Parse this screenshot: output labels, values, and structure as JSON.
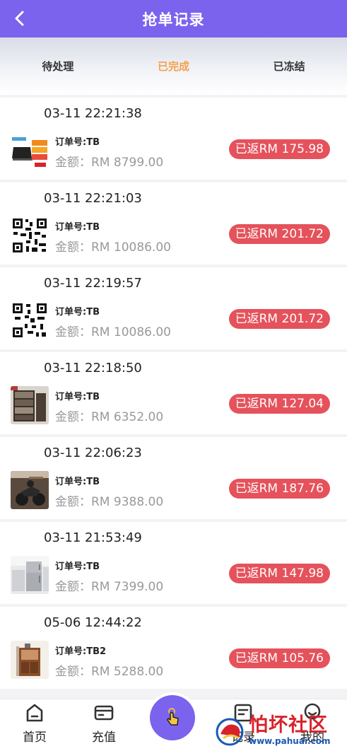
{
  "header": {
    "title": "抢单记录",
    "back_icon": "chevron-left-icon"
  },
  "tabs": [
    {
      "label": "待处理",
      "active": false
    },
    {
      "label": "已完成",
      "active": true
    },
    {
      "label": "已冻结",
      "active": false
    }
  ],
  "orders": [
    {
      "time": "03-11 22:21:38",
      "order_no": "订单号:TB",
      "amount": "金额：RM 8799.00",
      "rebate": "已返RM 175.98",
      "thumb": "laptop-image"
    },
    {
      "time": "03-11 22:21:03",
      "order_no": "订单号:TB",
      "amount": "金额：RM 10086.00",
      "rebate": "已返RM 201.72",
      "thumb": "qr-code-image"
    },
    {
      "time": "03-11 22:19:57",
      "order_no": "订单号:TB",
      "amount": "金额：RM 10086.00",
      "rebate": "已返RM 201.72",
      "thumb": "qr-code-image"
    },
    {
      "time": "03-11 22:18:50",
      "order_no": "订单号:TB",
      "amount": "金额：RM 6352.00",
      "rebate": "已返RM 127.04",
      "thumb": "bookshelf-image"
    },
    {
      "time": "03-11 22:06:23",
      "order_no": "订单号:TB",
      "amount": "金额：RM 9388.00",
      "rebate": "已返RM 187.76",
      "thumb": "motorcycle-image"
    },
    {
      "time": "03-11 21:53:49",
      "order_no": "订单号:TB",
      "amount": "金额：RM 7399.00",
      "rebate": "已返RM 147.98",
      "thumb": "refrigerator-image"
    },
    {
      "time": "05-06 12:44:22",
      "order_no": "订单号:TB2",
      "amount": "金额：RM 5288.00",
      "rebate": "已返RM 105.76",
      "thumb": "cabinet-image"
    }
  ],
  "tabbar": {
    "home": {
      "label": "首页",
      "icon": "home-icon"
    },
    "recharge": {
      "label": "充值",
      "icon": "card-icon"
    },
    "grab": {
      "icon": "tap-hand-icon"
    },
    "record": {
      "label": "记录",
      "icon": "record-icon"
    },
    "mine": {
      "label": "我的",
      "icon": "user-icon"
    }
  },
  "watermark": {
    "main": "怕坏社区",
    "sub": "www.pahuai.com"
  },
  "colors": {
    "accent": "#7b63ee",
    "active_tab": "#f6a14b",
    "badge": "#e5525b"
  }
}
